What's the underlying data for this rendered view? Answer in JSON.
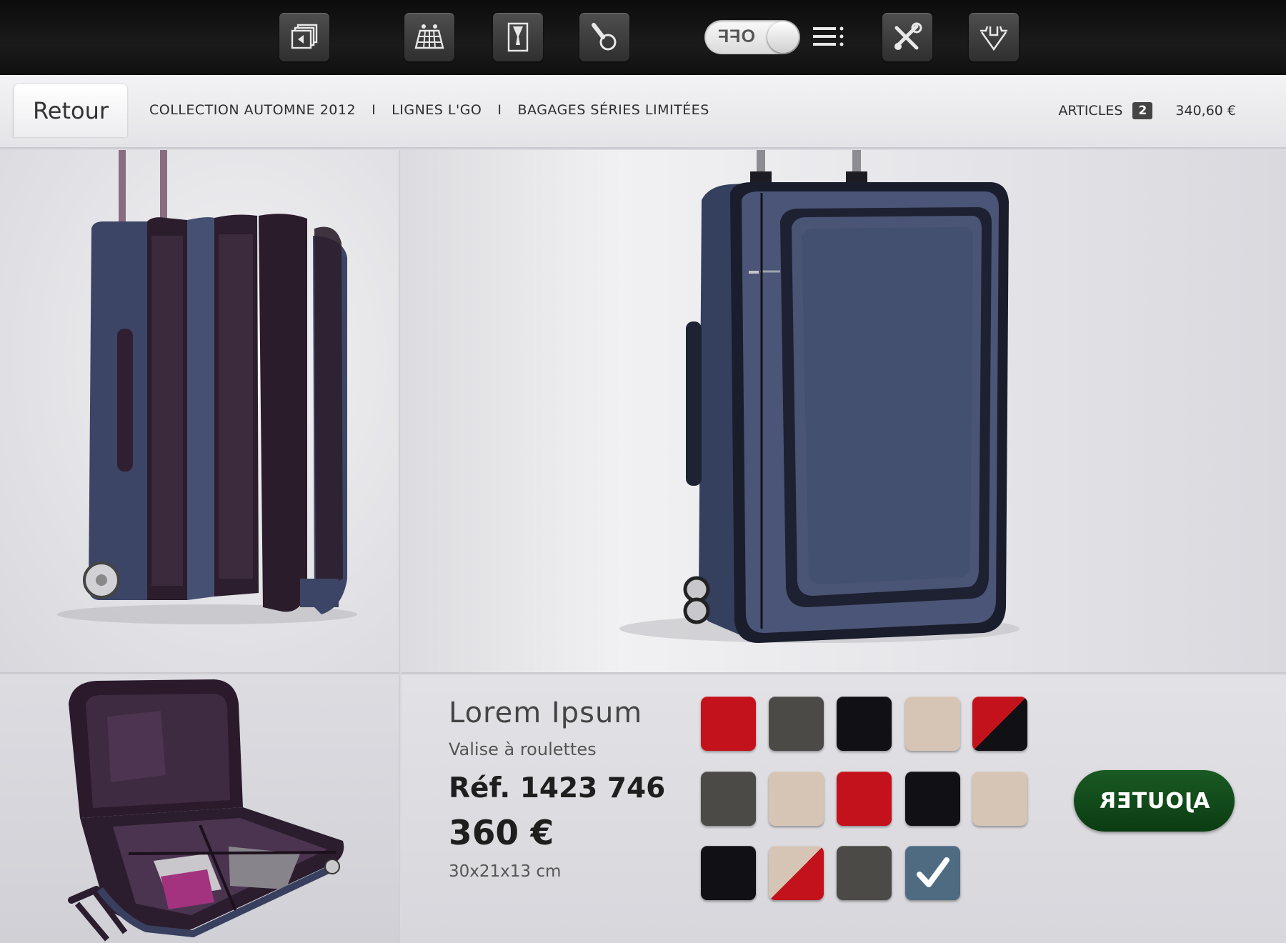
{
  "toolbar": {
    "buttons": [
      "gallery-icon",
      "grid-calendar-icon",
      "document-icon",
      "search-icon",
      "tools-icon",
      "basket-icon"
    ],
    "toggle_label": "OFF",
    "toggle_state": "off",
    "menu_icon": "list-icon"
  },
  "navbar": {
    "back_label": "Retour",
    "breadcrumbs": [
      "COLLECTION AUTOMNE 2012",
      "LIGNES L'GO",
      "BAGAGES SÉRIES LIMITÉES"
    ],
    "separator": "I",
    "cart_label": "ARTICLES",
    "cart_count": "2",
    "cart_total": "340,60 €"
  },
  "product": {
    "name": "Lorem Ipsum",
    "type": "Valise à roulettes",
    "ref": "Réf. 1423 746",
    "price": "360 €",
    "dimensions": "30x21x13 cm"
  },
  "swatches": [
    [
      "#c3121c",
      "#4b4a47",
      "#111115",
      "#d6c4b4",
      [
        "#c3121c",
        "#111115"
      ]
    ],
    [
      "#4b4a47",
      "#d6c4b4",
      "#c3121c",
      "#111115",
      "#d6c4b4"
    ],
    [
      "#111115",
      [
        "#d6c4b4",
        "#c3121c"
      ],
      "#4b4a47",
      "selected"
    ]
  ],
  "selected_swatch_color": "#4f6b82",
  "add_button_label": "AJOUTER",
  "colors": {
    "add_button": "#0f4a18",
    "toolbar": "#141414"
  }
}
